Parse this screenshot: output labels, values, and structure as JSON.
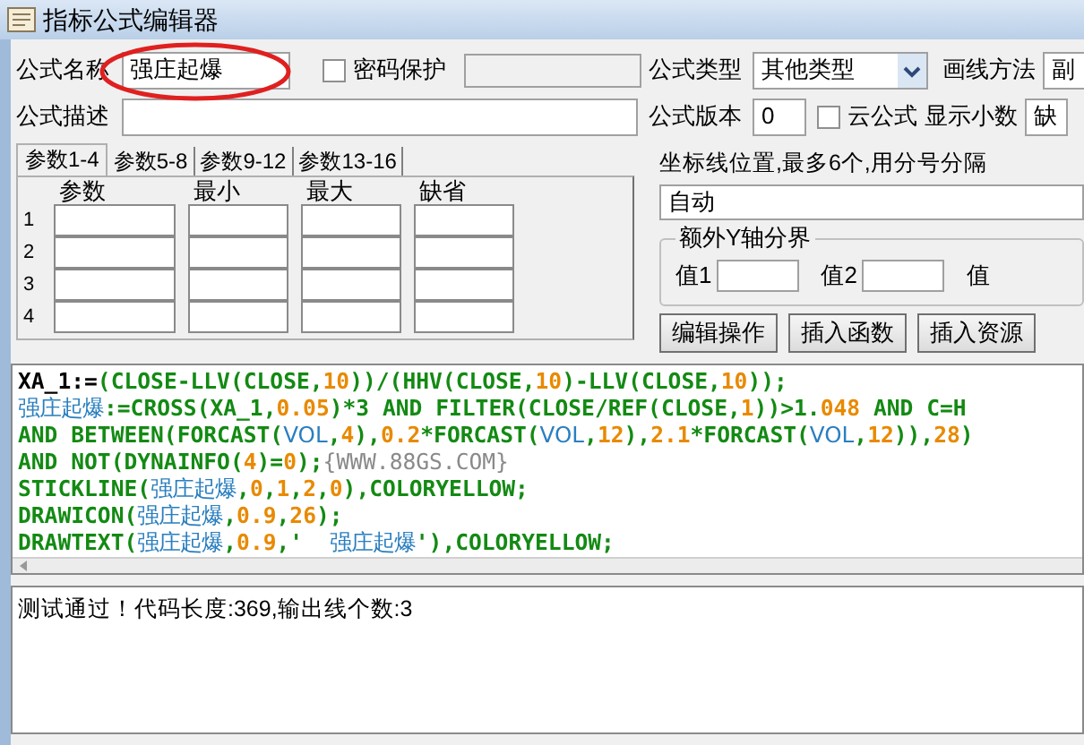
{
  "window": {
    "title": "指标公式编辑器"
  },
  "form": {
    "name_label": "公式名称",
    "name_value": "强庄起爆",
    "password": {
      "label": "密码保护",
      "checked": false
    },
    "type_label": "公式类型",
    "type_value": "其他类型",
    "draw_label": "画线方法",
    "draw_value": "副",
    "desc_label": "公式描述",
    "version_label": "公式版本",
    "version_value": "0",
    "cloud": {
      "label": "云公式",
      "checked": false
    },
    "decimals_label": "显示小数",
    "decimals_value": "缺"
  },
  "tabs": [
    {
      "label": "参数1-4",
      "selected": true
    },
    {
      "label": "参数5-8",
      "selected": false
    },
    {
      "label": "参数9-12",
      "selected": false
    },
    {
      "label": "参数13-16",
      "selected": false
    }
  ],
  "param_table": {
    "columns": [
      "参数",
      "最小",
      "最大",
      "缺省"
    ],
    "rows": [
      "1",
      "2",
      "3",
      "4"
    ]
  },
  "axis": {
    "label": "坐标线位置,最多6个,用分号分隔",
    "value": "自动",
    "group_title": "额外Y轴分界",
    "values": [
      {
        "label": "值1"
      },
      {
        "label": "值2"
      },
      {
        "label": "值"
      }
    ]
  },
  "buttons": [
    "编辑操作",
    "插入函数",
    "插入资源"
  ],
  "code_lines": [
    [
      {
        "text": "XA_1:=",
        "kind": "plain"
      },
      {
        "text": "(CLOSE-LLV(CLOSE,",
        "kind": "func"
      },
      {
        "text": "10",
        "kind": "num"
      },
      {
        "text": "))/(HHV(CLOSE,",
        "kind": "func"
      },
      {
        "text": "10",
        "kind": "num"
      },
      {
        "text": ")-LLV(CLOSE,",
        "kind": "func"
      },
      {
        "text": "10",
        "kind": "num"
      },
      {
        "text": "));",
        "kind": "func"
      }
    ],
    [
      {
        "text": "强庄起爆",
        "kind": "var"
      },
      {
        "text": ":=CROSS(XA_1,",
        "kind": "func"
      },
      {
        "text": "0.05",
        "kind": "num"
      },
      {
        "text": ")*3 AND FILTER(CLOSE/REF(CLOSE,",
        "kind": "func"
      },
      {
        "text": "1",
        "kind": "num"
      },
      {
        "text": "))>1.",
        "kind": "func"
      },
      {
        "text": "048",
        "kind": "num"
      },
      {
        "text": " AND C=H",
        "kind": "func"
      }
    ],
    [
      {
        "text": "AND BETWEEN(FORCAST(",
        "kind": "func"
      },
      {
        "text": "VOL",
        "kind": "var"
      },
      {
        "text": ",",
        "kind": "func"
      },
      {
        "text": "4",
        "kind": "num"
      },
      {
        "text": "),",
        "kind": "func"
      },
      {
        "text": "0.2",
        "kind": "num"
      },
      {
        "text": "*FORCAST(",
        "kind": "func"
      },
      {
        "text": "VOL",
        "kind": "var"
      },
      {
        "text": ",",
        "kind": "func"
      },
      {
        "text": "12",
        "kind": "num"
      },
      {
        "text": "),",
        "kind": "func"
      },
      {
        "text": "2.1",
        "kind": "num"
      },
      {
        "text": "*FORCAST(",
        "kind": "func"
      },
      {
        "text": "VOL",
        "kind": "var"
      },
      {
        "text": ",",
        "kind": "func"
      },
      {
        "text": "12",
        "kind": "num"
      },
      {
        "text": ")),",
        "kind": "func"
      },
      {
        "text": "28",
        "kind": "num"
      },
      {
        "text": ")",
        "kind": "func"
      }
    ],
    [
      {
        "text": "AND NOT(DYNAINFO(",
        "kind": "func"
      },
      {
        "text": "4",
        "kind": "num"
      },
      {
        "text": ")=",
        "kind": "func"
      },
      {
        "text": "0",
        "kind": "num"
      },
      {
        "text": ");",
        "kind": "func"
      },
      {
        "text": "{WWW.88GS.COM}",
        "kind": "comment"
      }
    ],
    [
      {
        "text": "STICKLINE(",
        "kind": "func"
      },
      {
        "text": "强庄起爆",
        "kind": "var"
      },
      {
        "text": ",",
        "kind": "func"
      },
      {
        "text": "0",
        "kind": "num"
      },
      {
        "text": ",",
        "kind": "func"
      },
      {
        "text": "1",
        "kind": "num"
      },
      {
        "text": ",",
        "kind": "func"
      },
      {
        "text": "2",
        "kind": "num"
      },
      {
        "text": ",",
        "kind": "func"
      },
      {
        "text": "0",
        "kind": "num"
      },
      {
        "text": "),COLORYELLOW;",
        "kind": "func"
      }
    ],
    [
      {
        "text": "DRAWICON(",
        "kind": "func"
      },
      {
        "text": "强庄起爆",
        "kind": "var"
      },
      {
        "text": ",",
        "kind": "func"
      },
      {
        "text": "0.9",
        "kind": "num"
      },
      {
        "text": ",",
        "kind": "func"
      },
      {
        "text": "26",
        "kind": "num"
      },
      {
        "text": ");",
        "kind": "func"
      }
    ],
    [
      {
        "text": "DRAWTEXT(",
        "kind": "func"
      },
      {
        "text": "强庄起爆",
        "kind": "var"
      },
      {
        "text": ",",
        "kind": "func"
      },
      {
        "text": "0.9",
        "kind": "num"
      },
      {
        "text": ",'  ",
        "kind": "func"
      },
      {
        "text": "强庄起爆",
        "kind": "var"
      },
      {
        "text": "'),COLORYELLOW;",
        "kind": "func"
      }
    ]
  ],
  "status": "测试通过！代码长度:369,输出线个数:3"
}
